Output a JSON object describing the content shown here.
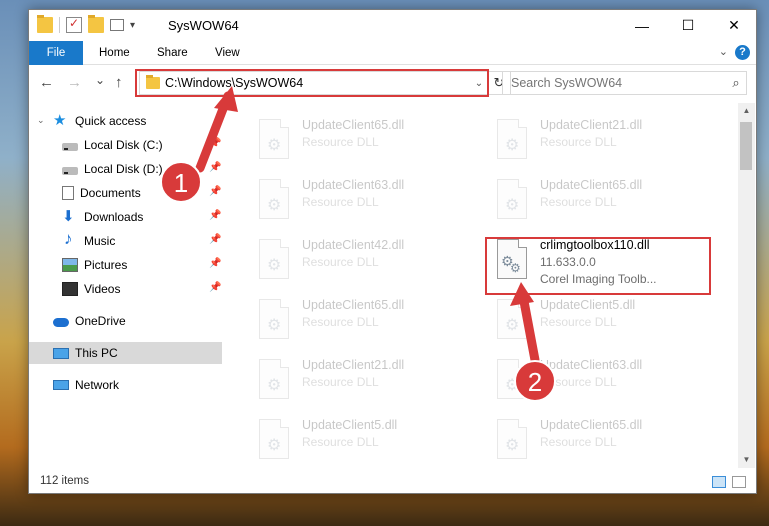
{
  "window": {
    "title": "SysWOW64",
    "minimize": "—",
    "maximize": "☐",
    "close": "✕"
  },
  "ribbon": {
    "tabs": [
      "File",
      "Home",
      "Share",
      "View"
    ]
  },
  "nav": {
    "back": "←",
    "forward": "→",
    "recent": "⌄",
    "up": "↑"
  },
  "address": {
    "path": "C:\\Windows\\SysWOW64",
    "refresh": "↻"
  },
  "search": {
    "placeholder": "Search SysWOW64"
  },
  "sidebar": {
    "items": [
      {
        "label": "Quick access",
        "icon": "star-icon",
        "pinned": false
      },
      {
        "label": "Local Disk (C:)",
        "icon": "disk-icon",
        "pinned": true
      },
      {
        "label": "Local Disk (D:)",
        "icon": "disk-icon",
        "pinned": true
      },
      {
        "label": "Documents",
        "icon": "documents-icon",
        "pinned": true
      },
      {
        "label": "Downloads",
        "icon": "download-icon",
        "pinned": true
      },
      {
        "label": "Music",
        "icon": "music-icon",
        "pinned": true
      },
      {
        "label": "Pictures",
        "icon": "pictures-icon",
        "pinned": true
      },
      {
        "label": "Videos",
        "icon": "videos-icon",
        "pinned": true
      },
      {
        "label": "OneDrive",
        "icon": "onedrive-icon"
      },
      {
        "label": "This PC",
        "icon": "pc-icon",
        "selected": true
      },
      {
        "label": "Network",
        "icon": "network-icon"
      }
    ]
  },
  "files": {
    "col1": [
      {
        "name": "UpdateClient65.dll",
        "type": "Resource DLL"
      },
      {
        "name": "UpdateClient63.dll",
        "type": "Resource DLL"
      },
      {
        "name": "UpdateClient42.dll",
        "type": "Resource DLL"
      },
      {
        "name": "UpdateClient65.dll",
        "type": "Resource DLL"
      },
      {
        "name": "UpdateClient21.dll",
        "type": "Resource DLL"
      },
      {
        "name": "UpdateClient5.dll",
        "type": "Resource DLL"
      }
    ],
    "col2": [
      {
        "name": "UpdateClient21.dll",
        "type": "Resource DLL"
      },
      {
        "name": "UpdateClient65.dll",
        "type": "Resource DLL"
      },
      {
        "name": "UpdateClient5.dll",
        "type": "Resource DLL"
      },
      {
        "name": "UpdateClient63.dll",
        "type": "Resource DLL"
      },
      {
        "name": "UpdateClient65.dll",
        "type": "Resource DLL"
      }
    ],
    "highlighted": {
      "name": "crlimgtoolbox110.dll",
      "version": "11.633.0.0",
      "description": "Corel Imaging Toolb..."
    }
  },
  "status": {
    "count": "112 items"
  },
  "callouts": {
    "one": "1",
    "two": "2"
  },
  "colors": {
    "accent": "#1979ca",
    "highlight": "#d83a3a"
  }
}
